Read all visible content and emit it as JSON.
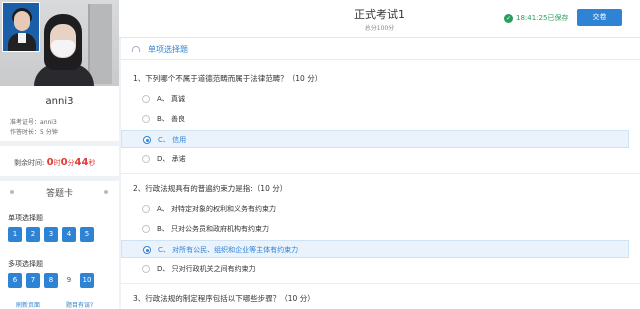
{
  "student": {
    "name": "anni3",
    "exam_id_label": "准考证号：",
    "exam_id": "anni3",
    "duration_label": "作答时长：",
    "duration": "5 分钟"
  },
  "timer": {
    "label": "剩余时间:",
    "hours": "0",
    "hours_unit": "时",
    "minutes": "0",
    "minutes_unit": "分",
    "seconds": "44",
    "seconds_unit": "秒"
  },
  "answer_card": {
    "title": "答题卡",
    "single_section": "单项选择题",
    "single_items": [
      "1",
      "2",
      "3",
      "4",
      "5"
    ],
    "multi_section": "多项选择题",
    "multi_items": [
      "6",
      "7",
      "8",
      "9",
      "10"
    ],
    "refresh_link": "刷新页面",
    "issue_link": "题目有误?"
  },
  "header": {
    "title": "正式考试1",
    "subtitle": "总分100分",
    "save_status": "18:41:25已保存",
    "submit_label": "交卷"
  },
  "section": {
    "title": "单项选择题"
  },
  "questions": [
    {
      "text": "1、下列哪个不属于道德范畴而属于法律范畴？（10 分）",
      "options": [
        {
          "label": "A、 真诚",
          "selected": false
        },
        {
          "label": "B、 善良",
          "selected": false
        },
        {
          "label": "C、 信用",
          "selected": true
        },
        {
          "label": "D、 承诺",
          "selected": false
        }
      ]
    },
    {
      "text": "2、行政法规具有的普遍约束力是指:（10 分）",
      "options": [
        {
          "label": "A、 对特定对象的权利和义务有约束力",
          "selected": false
        },
        {
          "label": "B、 只对公务员和政府机构有约束力",
          "selected": false
        },
        {
          "label": "C、 对所有公民、组织和企业等主体有约束力",
          "selected": true
        },
        {
          "label": "D、 只对行政机关之间有约束力",
          "selected": false
        }
      ]
    },
    {
      "text": "3、行政法规的制定程序包括以下哪些步骤？（10 分）",
      "options": []
    }
  ],
  "colors": {
    "accent": "#2f83d5",
    "timer": "#e53935",
    "saved": "#2a9d5c"
  },
  "icons": [
    "check-circle-icon",
    "section-icon",
    "radio-selected-icon",
    "radio-empty-icon"
  ]
}
